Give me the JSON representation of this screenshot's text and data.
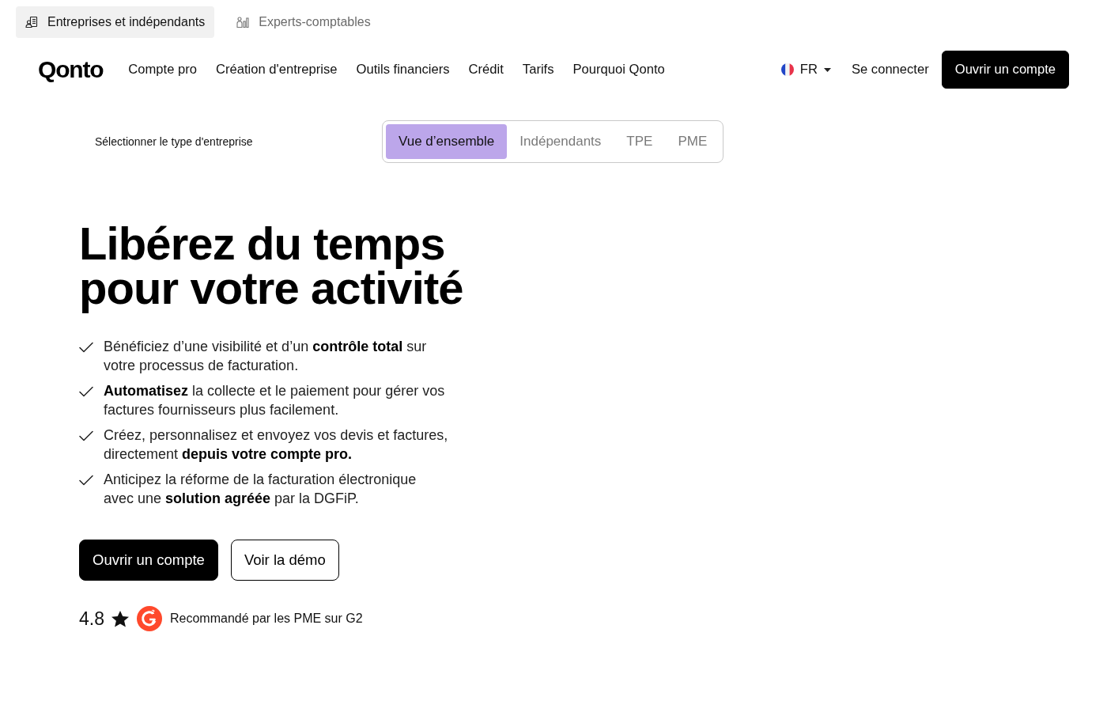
{
  "audience_tabs": [
    {
      "label": "Entreprises et indépendants",
      "selected": true,
      "kind": "business"
    },
    {
      "label": "Experts-comptables",
      "selected": false,
      "kind": "accountant"
    }
  ],
  "navbar": {
    "logo": "Qonto",
    "links": [
      "Compte pro",
      "Création d'entreprise",
      "Outils financiers",
      "Crédit",
      "Tarifs",
      "Pourquoi Qonto"
    ],
    "language": "FR",
    "login": "Se connecter",
    "cta": "Ouvrir un compte"
  },
  "business_type": {
    "label": "Sélectionner le type d'entreprise",
    "options": [
      {
        "label": "Vue d’ensemble",
        "selected": true
      },
      {
        "label": "Indépendants",
        "selected": false
      },
      {
        "label": "TPE",
        "selected": false
      },
      {
        "label": "PME",
        "selected": false
      }
    ]
  },
  "hero": {
    "title_lines": [
      "Libérez du temps",
      "pour votre activité"
    ],
    "benefits": [
      "Bénéficiez d’une visibilité et d’un **contrôle total** sur votre processus de facturation.",
      "**Automatisez** la collecte et le paiement pour gérer vos factures fournisseurs plus facilement.",
      "Créez, personnalisez et envoyez vos devis et factures, directement **depuis votre compte pro.**",
      "Anticipez la réforme de la facturation électronique avec une **solution agréée** par la DGFiP."
    ],
    "buttons": [
      {
        "label": "Ouvrir un compte",
        "kind": "primary"
      },
      {
        "label": "Voir la démo",
        "kind": "secondary"
      }
    ],
    "rating": {
      "score": "4.8",
      "text": "Recommandé par les PME sur G2"
    }
  }
}
